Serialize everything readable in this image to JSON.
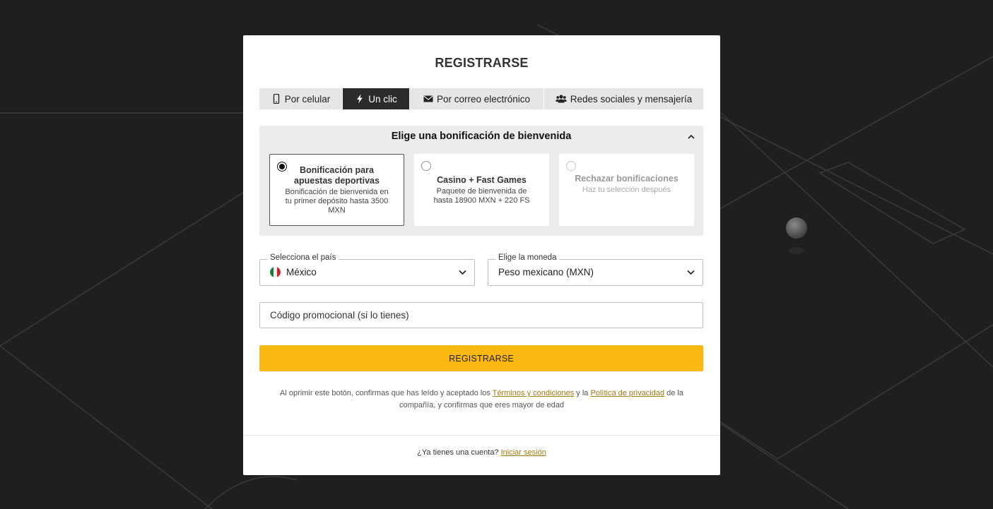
{
  "modal": {
    "title": "REGISTRARSE"
  },
  "tabs": [
    {
      "label": "Por celular",
      "icon": "phone-icon"
    },
    {
      "label": "Un clic",
      "icon": "lightning-icon",
      "active": true
    },
    {
      "label": "Por correo electrónico",
      "icon": "envelope-icon"
    },
    {
      "label": "Redes sociales y mensajería",
      "icon": "users-icon"
    }
  ],
  "bonus": {
    "title": "Elige una bonificación de bienvenida",
    "cards": [
      {
        "name": "Bonificación para apuestas deportivas",
        "desc": "Bonificación de bienvenida en tu primer depósito hasta 3500 MXN",
        "selected": true
      },
      {
        "name": "Casino + Fast Games",
        "desc": "Paquete de bienvenida de hasta 18900 MXN + 220 FS",
        "selected": false
      },
      {
        "name": "Rechazar bonificaciones",
        "desc": "Haz tu selección después",
        "selected": false
      }
    ]
  },
  "country": {
    "label": "Selecciona el país",
    "value": "México"
  },
  "currency": {
    "label": "Elige la moneda",
    "value": "Peso mexicano (MXN)"
  },
  "promo": {
    "placeholder": "Código promocional (si lo tienes)"
  },
  "register_button": "REGISTRARSE",
  "terms": {
    "prefix": "Al oprimir este botón, confirmas que has leído y aceptado los",
    "terms_link": "Términos y condiciones",
    "middle": "y la",
    "privacy_link": "Política de privacidad",
    "suffix": "de la compañía, y confirmas que eres mayor de edad"
  },
  "footer": {
    "question": "¿Ya tienes una cuenta?",
    "login_link": "Iniciar sesión"
  },
  "colors": {
    "accent": "#fbb812",
    "link": "#a07a10",
    "active_tab": "#2b2b2b",
    "background": "#1f1f1f"
  }
}
